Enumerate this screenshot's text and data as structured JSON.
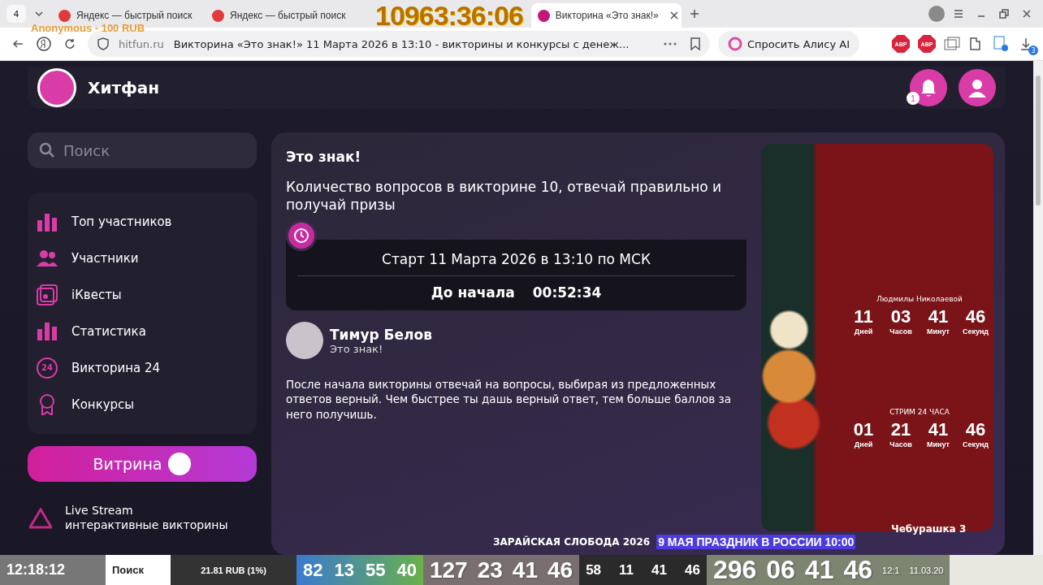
{
  "overlay": {
    "timer": "10963:36:06",
    "donation": "Anonymous - 100 RUB",
    "ticker": [
      "ЗАРАЙСКАЯ СЛОБОДА 2026",
      "9 МАЯ ПРАЗДНИК В РОССИИ 10:00"
    ]
  },
  "browser": {
    "tab_count": "4",
    "tabs": [
      {
        "title": "Яндекс — быстрый поиск",
        "selected": false
      },
      {
        "title": "Яндекс — быстрый поиск",
        "selected": false
      },
      {
        "title": "Викторина «Это знак!»",
        "selected": true
      }
    ],
    "domain": "hitfun.ru",
    "page_title": "Викторина «Это знак!» 11 Марта 2026 в 13:10 - викторины и конкурсы с денеж...",
    "alice_button": "Спросить Алису AI",
    "extensions": [
      "ABP",
      "ABP"
    ],
    "downloads_badge": "3"
  },
  "site": {
    "logo": "Хитфан",
    "notifications_badge": "1",
    "search": {
      "placeholder": "Поиск"
    },
    "nav": [
      {
        "label": "Топ участников"
      },
      {
        "label": "Участники"
      },
      {
        "label": "iКвесты"
      },
      {
        "label": "Статистика"
      },
      {
        "label": "Викторина 24",
        "icon_text": "24"
      },
      {
        "label": "Конкурсы"
      }
    ],
    "showcase_button": "Витрина",
    "live": {
      "title": "Live Stream",
      "subtitle": "интерактивные викторины"
    }
  },
  "quiz": {
    "title": "Это знак!",
    "description": "Количество вопросов в викторине 10, отвечай правильно и получай призы",
    "start": "Старт 11 Марта 2026 в 13:10 по МСК",
    "countdown_label": "До начала",
    "countdown": "00:52:34",
    "author": {
      "name": "Тимур Белов",
      "subtitle": "Это знак!"
    },
    "rules": "После начала викторины отвечай на вопросы, выбирая из предложенных ответов верный. Чем быстрее ты дашь верный ответ, тем больше баллов за него получишь."
  },
  "image_overlay": {
    "timers": [
      {
        "title": "Людмилы Николаевой",
        "units": [
          {
            "value": "11",
            "label": "Дней"
          },
          {
            "value": "03",
            "label": "Часов"
          },
          {
            "value": "41",
            "label": "Минут"
          },
          {
            "value": "46",
            "label": "Секунд"
          }
        ]
      },
      {
        "title": "СТРИМ 24 ЧАСА",
        "units": [
          {
            "value": "01",
            "label": "Дней"
          },
          {
            "value": "21",
            "label": "Часов"
          },
          {
            "value": "41",
            "label": "Минут"
          },
          {
            "value": "46",
            "label": "Секунд"
          }
        ]
      }
    ],
    "caption": "Чебурашка 3"
  },
  "bottom_strip": {
    "clock": "12:18:12",
    "search": "Поиск",
    "donation_total": "21.81 RUB (1%)",
    "groups": [
      [
        "82",
        "13",
        "55",
        "40"
      ],
      [
        "127",
        "23",
        "41",
        "46"
      ],
      [
        "58",
        "11",
        "41",
        "46"
      ],
      [
        "296",
        "06",
        "41",
        "46"
      ]
    ],
    "tray_time": "12:1",
    "tray_date": "11.03.20"
  }
}
